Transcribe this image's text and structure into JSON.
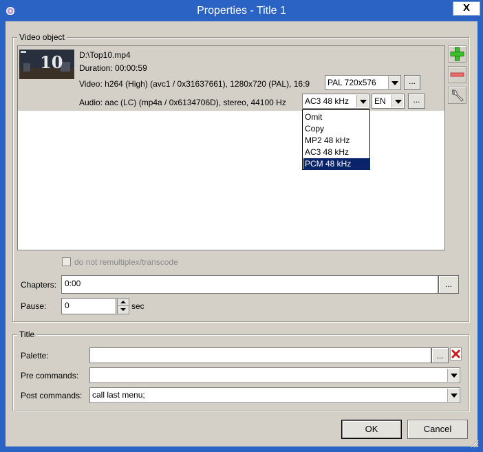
{
  "window": {
    "title": "Properties - Title 1",
    "close_label": "X"
  },
  "video_object": {
    "legend": "Video object",
    "thumbnail_text": "10",
    "file": "D:\\Top10.mp4",
    "duration": "Duration: 00:00:59",
    "video_info": "Video: h264 (High) (avc1 / 0x31637661), 1280x720 (PAL), 16:9",
    "video_format": "PAL 720x576",
    "audio_info": "Audio: aac (LC) (mp4a / 0x6134706D), stereo, 44100 Hz",
    "audio_format": "AC3 48 kHz",
    "audio_language": "EN",
    "ellipsis": "...",
    "audio_options": [
      "Omit",
      "Copy",
      "MP2 48 kHz",
      "AC3 48 kHz",
      "PCM 48 kHz"
    ],
    "audio_option_selected": "PCM 48 kHz",
    "no_remux_label": "do not remultiplex/transcode",
    "chapters_label": "Chapters:",
    "chapters_value": "0:00",
    "pause_label": "Pause:",
    "pause_value": "0",
    "pause_unit": "sec"
  },
  "title_group": {
    "legend": "Title",
    "palette_label": "Palette:",
    "palette_value": "",
    "pre_commands_label": "Pre commands:",
    "pre_commands_value": "",
    "post_commands_label": "Post commands:",
    "post_commands_value": "call last menu;"
  },
  "buttons": {
    "ok": "OK",
    "cancel": "Cancel"
  },
  "colors": {
    "title_bar": "#2b63c4",
    "dialog_bg": "#d4d0c8",
    "selection": "#0a246a",
    "add_icon": "#3bbf2a",
    "remove_icon": "#e86a6a",
    "clear_icon": "#d11a1a"
  },
  "icons": {
    "add": "plus-icon",
    "remove": "minus-icon",
    "settings": "wrench-icon",
    "clear": "x-icon"
  }
}
